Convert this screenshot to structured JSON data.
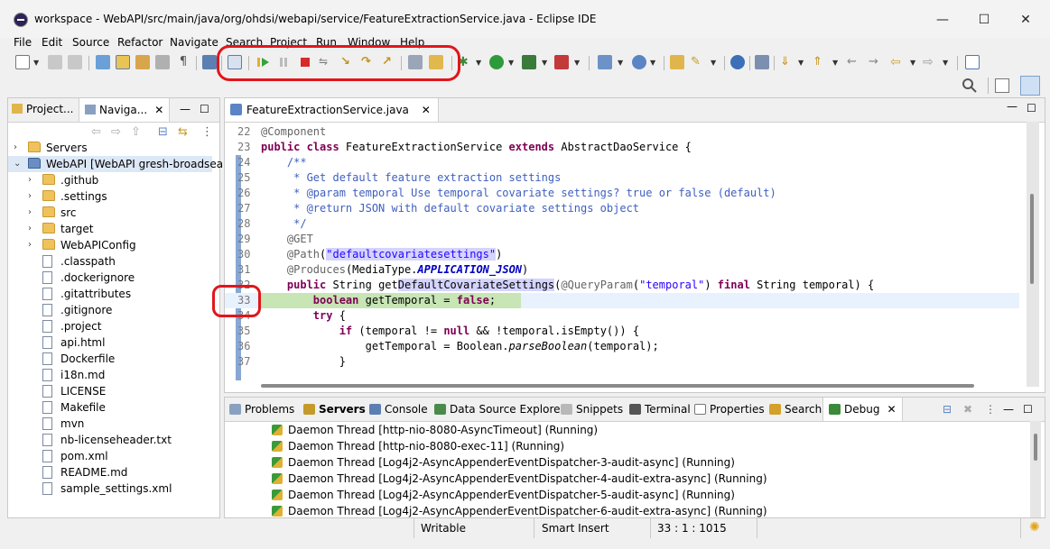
{
  "window": {
    "title": "workspace - WebAPI/src/main/java/org/ohdsi/webapi/service/FeatureExtractionService.java - Eclipse IDE",
    "minimize": "—",
    "maximize": "☐",
    "close": "✕"
  },
  "menu": [
    "File",
    "Edit",
    "Source",
    "Refactor",
    "Navigate",
    "Search",
    "Project",
    "Run",
    "Window",
    "Help"
  ],
  "left_pane": {
    "tabs": [
      "Project...",
      "Naviga..."
    ],
    "tree": [
      {
        "label": "Servers",
        "type": "folder",
        "level": 0,
        "arrow": "›"
      },
      {
        "label": "WebAPI [WebAPI gresh-broadsea]",
        "type": "project",
        "level": 0,
        "arrow": "⌄"
      },
      {
        "label": ".github",
        "type": "folder",
        "level": 1,
        "arrow": "›"
      },
      {
        "label": ".settings",
        "type": "folder",
        "level": 1,
        "arrow": "›"
      },
      {
        "label": "src",
        "type": "folder",
        "level": 1,
        "arrow": "›"
      },
      {
        "label": "target",
        "type": "folder",
        "level": 1,
        "arrow": "›"
      },
      {
        "label": "WebAPIConfig",
        "type": "folder",
        "level": 1,
        "arrow": "›"
      },
      {
        "label": ".classpath",
        "type": "file",
        "level": 1,
        "arrow": ""
      },
      {
        "label": ".dockerignore",
        "type": "file",
        "level": 1,
        "arrow": ""
      },
      {
        "label": ".gitattributes",
        "type": "file",
        "level": 1,
        "arrow": ""
      },
      {
        "label": ".gitignore",
        "type": "file",
        "level": 1,
        "arrow": ""
      },
      {
        "label": ".project",
        "type": "file",
        "level": 1,
        "arrow": ""
      },
      {
        "label": "api.html",
        "type": "file",
        "level": 1,
        "arrow": ""
      },
      {
        "label": "Dockerfile",
        "type": "file",
        "level": 1,
        "arrow": ""
      },
      {
        "label": "i18n.md",
        "type": "file",
        "level": 1,
        "arrow": ""
      },
      {
        "label": "LICENSE",
        "type": "file",
        "level": 1,
        "arrow": ""
      },
      {
        "label": "Makefile",
        "type": "file",
        "level": 1,
        "arrow": ""
      },
      {
        "label": "mvn",
        "type": "file",
        "level": 1,
        "arrow": ""
      },
      {
        "label": "nb-licenseheader.txt",
        "type": "file",
        "level": 1,
        "arrow": ""
      },
      {
        "label": "pom.xml",
        "type": "file",
        "level": 1,
        "arrow": ""
      },
      {
        "label": "README.md",
        "type": "file",
        "level": 1,
        "arrow": ""
      },
      {
        "label": "sample_settings.xml",
        "type": "file",
        "level": 1,
        "arrow": ""
      }
    ]
  },
  "editor": {
    "tab_label": "FeatureExtractionService.java",
    "line_numbers": [
      "22",
      "23",
      "24",
      "25",
      "26",
      "27",
      "28",
      "29",
      "30",
      "31",
      "32",
      "33",
      "34",
      "35",
      "36",
      "37"
    ],
    "current_line": "33"
  },
  "bottom_pane": {
    "tabs": [
      "Problems",
      "Servers",
      "Console",
      "Data Source Explorer",
      "Snippets",
      "Terminal",
      "Properties",
      "Search",
      "Debug"
    ],
    "threads": [
      "Daemon Thread [http-nio-8080-AsyncTimeout] (Running)",
      "Daemon Thread [http-nio-8080-exec-11] (Running)",
      "Daemon Thread [Log4j2-AsyncAppenderEventDispatcher-3-audit-async] (Running)",
      "Daemon Thread [Log4j2-AsyncAppenderEventDispatcher-4-audit-extra-async] (Running)",
      "Daemon Thread [Log4j2-AsyncAppenderEventDispatcher-5-audit-async] (Running)",
      "Daemon Thread [Log4j2-AsyncAppenderEventDispatcher-6-audit-extra-async] (Running)"
    ]
  },
  "status": {
    "writable": "Writable",
    "insert_mode": "Smart Insert",
    "position": "33 : 1 : 1015"
  },
  "colors": {
    "annotation_red": "#e1161b",
    "keyword": "#7f0055",
    "comment": "#3f5fbf",
    "string": "#2a00ff",
    "current_line": "#e8f2fe",
    "debug_line": "#c7e5b5"
  }
}
